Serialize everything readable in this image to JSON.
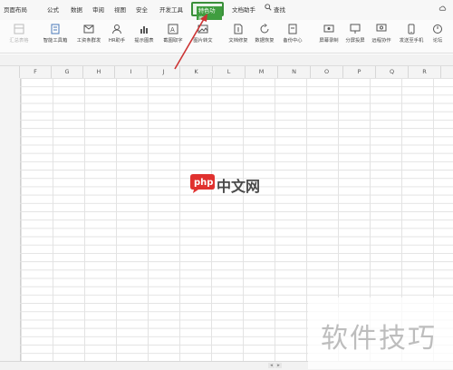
{
  "menubar": {
    "items": [
      "页面布局",
      "公式",
      "数据",
      "审阅",
      "视图",
      "安全",
      "开发工具"
    ],
    "active": "特色功能",
    "after": [
      "文档助手"
    ],
    "search": "查找"
  },
  "toolbar": {
    "tools": [
      {
        "label": "汇总表格",
        "icon": "table-icon",
        "disabled": true
      },
      {
        "label": "智能工具箱",
        "icon": "toolbox-icon",
        "disabled": false
      },
      {
        "label": "工资条群发",
        "icon": "mail-icon",
        "disabled": false
      },
      {
        "label": "HR助手",
        "icon": "user-icon",
        "disabled": false
      },
      {
        "label": "提示图表",
        "icon": "chart-icon",
        "disabled": false
      },
      {
        "label": "截图取字",
        "icon": "screenshot-icon",
        "disabled": false
      },
      {
        "label": "图片转文",
        "icon": "image-icon",
        "disabled": false
      },
      {
        "label": "文档修复",
        "icon": "doc-icon",
        "disabled": false
      },
      {
        "label": "数据恢复",
        "icon": "recover-icon",
        "disabled": false
      },
      {
        "label": "备份中心",
        "icon": "backup-icon",
        "disabled": false
      },
      {
        "label": "屏幕录制",
        "icon": "record-icon",
        "disabled": false
      },
      {
        "label": "分屏投屏",
        "icon": "monitor-icon",
        "disabled": false
      },
      {
        "label": "远程协作",
        "icon": "remote-icon",
        "disabled": false
      },
      {
        "label": "发送至手机",
        "icon": "phone-icon",
        "disabled": false
      },
      {
        "label": "论坛",
        "icon": "forum-icon",
        "disabled": false
      }
    ]
  },
  "sheet": {
    "columns": [
      "F",
      "G",
      "H",
      "I",
      "J",
      "K",
      "L",
      "M",
      "N",
      "O",
      "P",
      "Q",
      "R"
    ]
  },
  "watermark": {
    "logo_php": "php",
    "logo_cn": "中文网",
    "corner": "软件技巧"
  },
  "colors": {
    "active_tab_border": "#3a8f3a",
    "arrow": "#cc3333"
  }
}
